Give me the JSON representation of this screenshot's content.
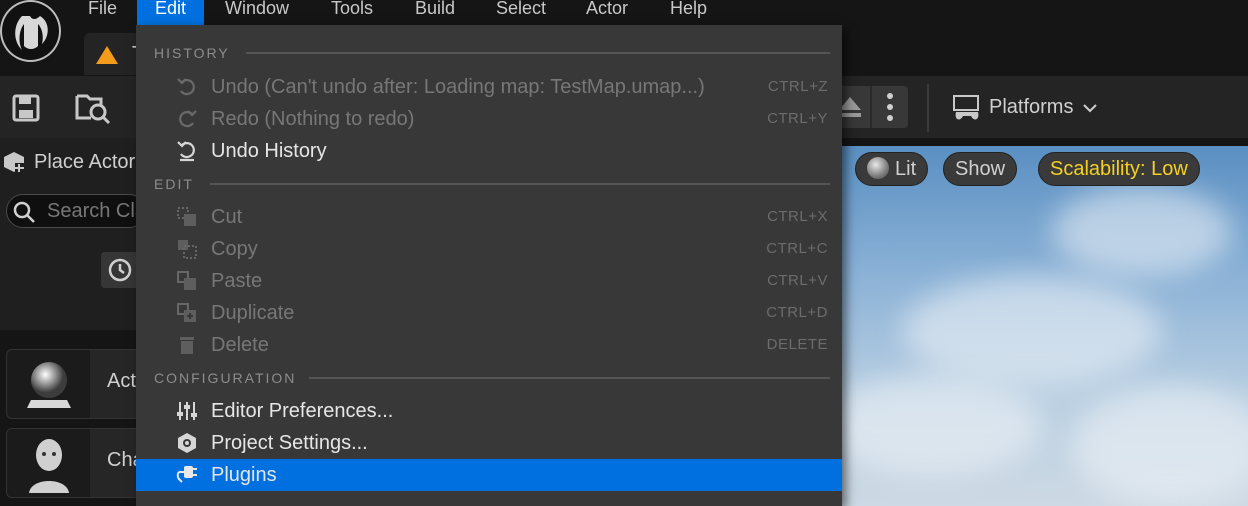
{
  "menubar": {
    "items": [
      "File",
      "Edit",
      "Window",
      "Tools",
      "Build",
      "Select",
      "Actor",
      "Help"
    ],
    "active": "Edit"
  },
  "tab": {
    "label": "T"
  },
  "toolbar": {
    "platforms_label": "Platforms"
  },
  "left_panel": {
    "place_actors": "Place Actor",
    "search_placeholder": "Search Cla",
    "actors": [
      "Act",
      "Cha"
    ]
  },
  "viewport": {
    "lit_label": "Lit",
    "show_label": "Show",
    "scalability_label": "Scalability: Low",
    "scalability_color": "#f5d020"
  },
  "edit_menu": {
    "sections": [
      {
        "title": "HISTORY",
        "items": [
          {
            "label": "Undo (Can't undo after: Loading map: TestMap.umap...)",
            "shortcut": "CTRL+Z",
            "enabled": false,
            "icon": "undo-icon"
          },
          {
            "label": "Redo (Nothing to redo)",
            "shortcut": "CTRL+Y",
            "enabled": false,
            "icon": "redo-icon"
          },
          {
            "label": "Undo History",
            "shortcut": "",
            "enabled": true,
            "icon": "undo-history-icon"
          }
        ]
      },
      {
        "title": "EDIT",
        "items": [
          {
            "label": "Cut",
            "shortcut": "CTRL+X",
            "enabled": false,
            "icon": "cut-icon"
          },
          {
            "label": "Copy",
            "shortcut": "CTRL+C",
            "enabled": false,
            "icon": "copy-icon"
          },
          {
            "label": "Paste",
            "shortcut": "CTRL+V",
            "enabled": false,
            "icon": "paste-icon"
          },
          {
            "label": "Duplicate",
            "shortcut": "CTRL+D",
            "enabled": false,
            "icon": "duplicate-icon"
          },
          {
            "label": "Delete",
            "shortcut": "DELETE",
            "enabled": false,
            "icon": "trash-icon"
          }
        ]
      },
      {
        "title": "CONFIGURATION",
        "items": [
          {
            "label": "Editor Preferences...",
            "shortcut": "",
            "enabled": true,
            "icon": "sliders-icon"
          },
          {
            "label": "Project Settings...",
            "shortcut": "",
            "enabled": true,
            "icon": "project-settings-icon"
          },
          {
            "label": "Plugins",
            "shortcut": "",
            "enabled": true,
            "highlighted": true,
            "icon": "plugin-icon"
          }
        ]
      }
    ]
  },
  "colors": {
    "accent": "#0070e0",
    "menu_bg": "#383838",
    "warning": "#f39b1a"
  }
}
